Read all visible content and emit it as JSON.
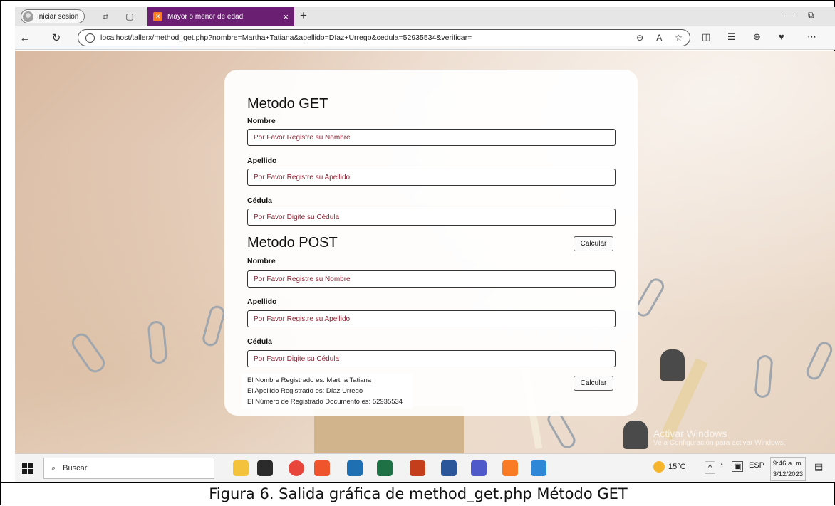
{
  "browser": {
    "profile_label": "Iniciar sesión",
    "tab_title": "Mayor o menor de edad",
    "tab_close": "×",
    "new_tab": "+",
    "url": "localhost/tallerx/method_get.php?nombre=Martha+Tatiana&apellido=Díaz+Urrego&cedula=52935534&verificar="
  },
  "page": {
    "get_section": {
      "title": "Metodo GET",
      "nombre_label": "Nombre",
      "nombre_placeholder": "Por Favor Registre su Nombre",
      "apellido_label": "Apellido",
      "apellido_placeholder": "Por Favor Registre su Apellido",
      "cedula_label": "Cédula",
      "cedula_placeholder": "Por Favor Digite su Cédula",
      "button_label": "Calcular"
    },
    "post_section": {
      "title": "Metodo POST",
      "nombre_label": "Nombre",
      "nombre_placeholder": "Por Favor Registre su Nombre",
      "apellido_label": "Apellido",
      "apellido_placeholder": "Por Favor Registre su Apellido",
      "cedula_label": "Cédula",
      "cedula_placeholder": "Por Favor Digite su Cédula",
      "button_label": "Calcular"
    },
    "results": [
      "El Nombre Registrado es: Martha Tatiana",
      "El Apellido Registrado es: Díaz Urrego",
      "El Número de Registrado Documento es: 52935534"
    ]
  },
  "watermark": {
    "title": "Activar Windows",
    "subtitle": "Ve a Configuración para activar Windows."
  },
  "taskbar": {
    "search_label": "Buscar",
    "temperature": "15°C",
    "language": "ESP",
    "time": "9:46 a. m.",
    "date": "3/12/2023"
  },
  "caption": "Figura 6. Salida gráfica de method_get.php Método GET",
  "colors": {
    "tab_active": "#6b1f73",
    "placeholder_text": "#8a2232",
    "xampp_orange": "#fb7a24"
  }
}
